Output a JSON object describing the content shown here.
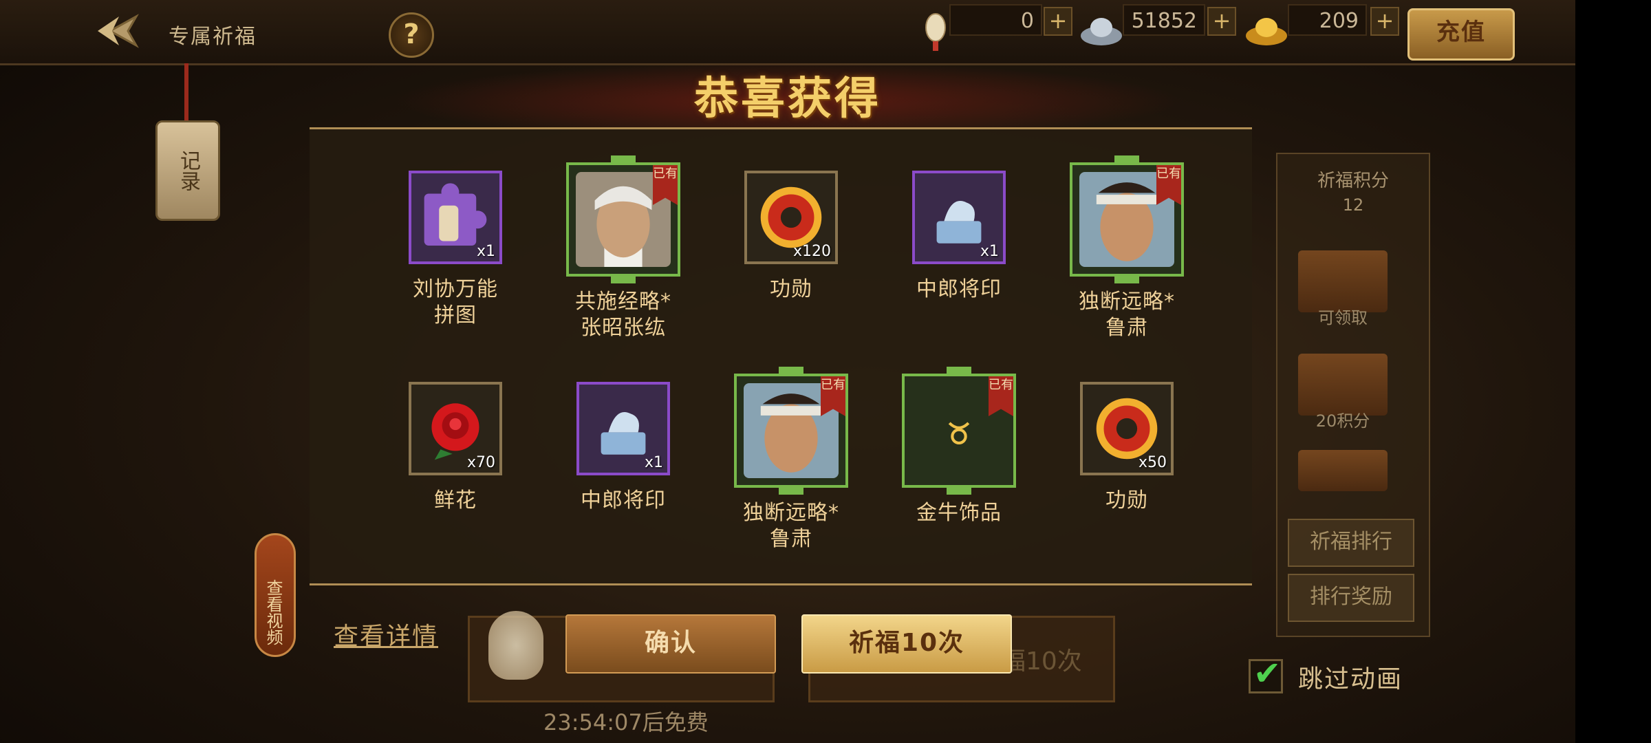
{
  "header": {
    "title": "专属祈福",
    "help_label": "?",
    "currencies": [
      {
        "icon": "lantern-icon",
        "value": "0"
      },
      {
        "icon": "silver-ingot-icon",
        "value": "51852"
      },
      {
        "icon": "gold-ingot-icon",
        "value": "209"
      }
    ],
    "plus_label": "+",
    "recharge_label": "充值"
  },
  "record_tab": "记录",
  "side_panel": {
    "points_title": "祈福积分",
    "points_value": "12",
    "chest1_label": "可领取",
    "chest2_label": "20积分",
    "rank_button": "祈福排行",
    "rank_reward_button": "排行奖励"
  },
  "modal": {
    "title": "恭喜获得",
    "owned_label": "已有",
    "items": [
      {
        "name": "刘协万能\n拼图",
        "qty": "x1",
        "frame": "purple",
        "icon": "puzzle-piece-icon",
        "owned": false
      },
      {
        "name": "共施经略*\n张昭张纮",
        "qty": "",
        "frame": "green",
        "icon": "general-portrait-icon",
        "owned": true
      },
      {
        "name": "功勋",
        "qty": "x120",
        "frame": "gold",
        "icon": "merit-medal-icon",
        "owned": false
      },
      {
        "name": "中郎将印",
        "qty": "x1",
        "frame": "purple",
        "icon": "official-seal-icon",
        "owned": false
      },
      {
        "name": "独断远略*\n鲁肃",
        "qty": "",
        "frame": "green",
        "icon": "general-portrait-icon",
        "owned": true
      },
      {
        "name": "鲜花",
        "qty": "x70",
        "frame": "gold",
        "icon": "rose-icon",
        "owned": false
      },
      {
        "name": "中郎将印",
        "qty": "x1",
        "frame": "purple",
        "icon": "official-seal-icon",
        "owned": false
      },
      {
        "name": "独断远略*\n鲁肃",
        "qty": "",
        "frame": "green",
        "icon": "general-portrait-icon",
        "owned": true
      },
      {
        "name": "金牛饰品",
        "qty": "",
        "frame": "green",
        "icon": "taurus-ornament-icon",
        "owned": true
      },
      {
        "name": "功勋",
        "qty": "x50",
        "frame": "gold",
        "icon": "merit-medal-icon",
        "owned": false
      }
    ]
  },
  "bottom": {
    "details_link": "查看详情",
    "confirm_label": "确认",
    "pray10_label": "祈福10次",
    "bg_pray10_label": "福10次",
    "timer": "23:54:07后免费",
    "skip_label": "跳过动画",
    "skip_checked": true,
    "video_label": "查看视频"
  },
  "colors": {
    "accent_gold": "#f4cf6a",
    "green_frame": "#78b94a",
    "purple_frame": "#8b4bc9",
    "owned_badge": "#a8261c"
  }
}
